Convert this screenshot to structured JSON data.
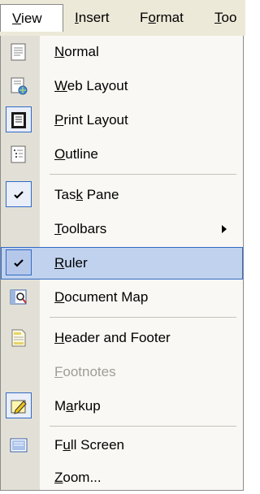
{
  "menubar": {
    "items": [
      {
        "label": "View",
        "mnemonic": "V"
      },
      {
        "label": "Insert",
        "mnemonic": "I"
      },
      {
        "label": "Format",
        "mnemonic": "o"
      },
      {
        "label": "Too",
        "mnemonic": "T"
      }
    ]
  },
  "menu": {
    "items": [
      {
        "label_pre": "",
        "mnemonic": "N",
        "label_post": "ormal",
        "icon": "normal-view-icon"
      },
      {
        "label_pre": "",
        "mnemonic": "W",
        "label_post": "eb Layout",
        "icon": "web-layout-icon"
      },
      {
        "label_pre": "",
        "mnemonic": "P",
        "label_post": "rint Layout",
        "icon": "print-layout-icon",
        "checked": true
      },
      {
        "label_pre": "",
        "mnemonic": "O",
        "label_post": "utline",
        "icon": "outline-view-icon"
      },
      {
        "label_pre": "Tas",
        "mnemonic": "k",
        "label_post": " Pane",
        "icon": "checkmark-icon",
        "checked": true
      },
      {
        "label_pre": "",
        "mnemonic": "T",
        "label_post": "oolbars",
        "submenu": true
      },
      {
        "label_pre": "",
        "mnemonic": "R",
        "label_post": "uler",
        "icon": "checkmark-icon",
        "checked": true,
        "highlighted": true
      },
      {
        "label_pre": "",
        "mnemonic": "D",
        "label_post": "ocument Map",
        "icon": "document-map-icon"
      },
      {
        "label_pre": "",
        "mnemonic": "H",
        "label_post": "eader and Footer",
        "icon": "header-footer-icon"
      },
      {
        "label_pre": "",
        "mnemonic": "F",
        "label_post": "ootnotes",
        "disabled": true
      },
      {
        "label_pre": "M",
        "mnemonic": "a",
        "label_post": "rkup",
        "icon": "markup-icon",
        "checked": true
      },
      {
        "label_pre": "F",
        "mnemonic": "u",
        "label_post": "ll Screen",
        "icon": "full-screen-icon"
      },
      {
        "label_pre": "",
        "mnemonic": "Z",
        "label_post": "oom...",
        "icon": ""
      }
    ]
  },
  "colors": {
    "menubar_bg": "#ece9d8",
    "gutter": "#e2e0d6",
    "menu_bg": "#f9f8f4",
    "highlight_bg": "#c1d2ee",
    "highlight_border": "#316ac5",
    "disabled_text": "#9f9d94"
  }
}
